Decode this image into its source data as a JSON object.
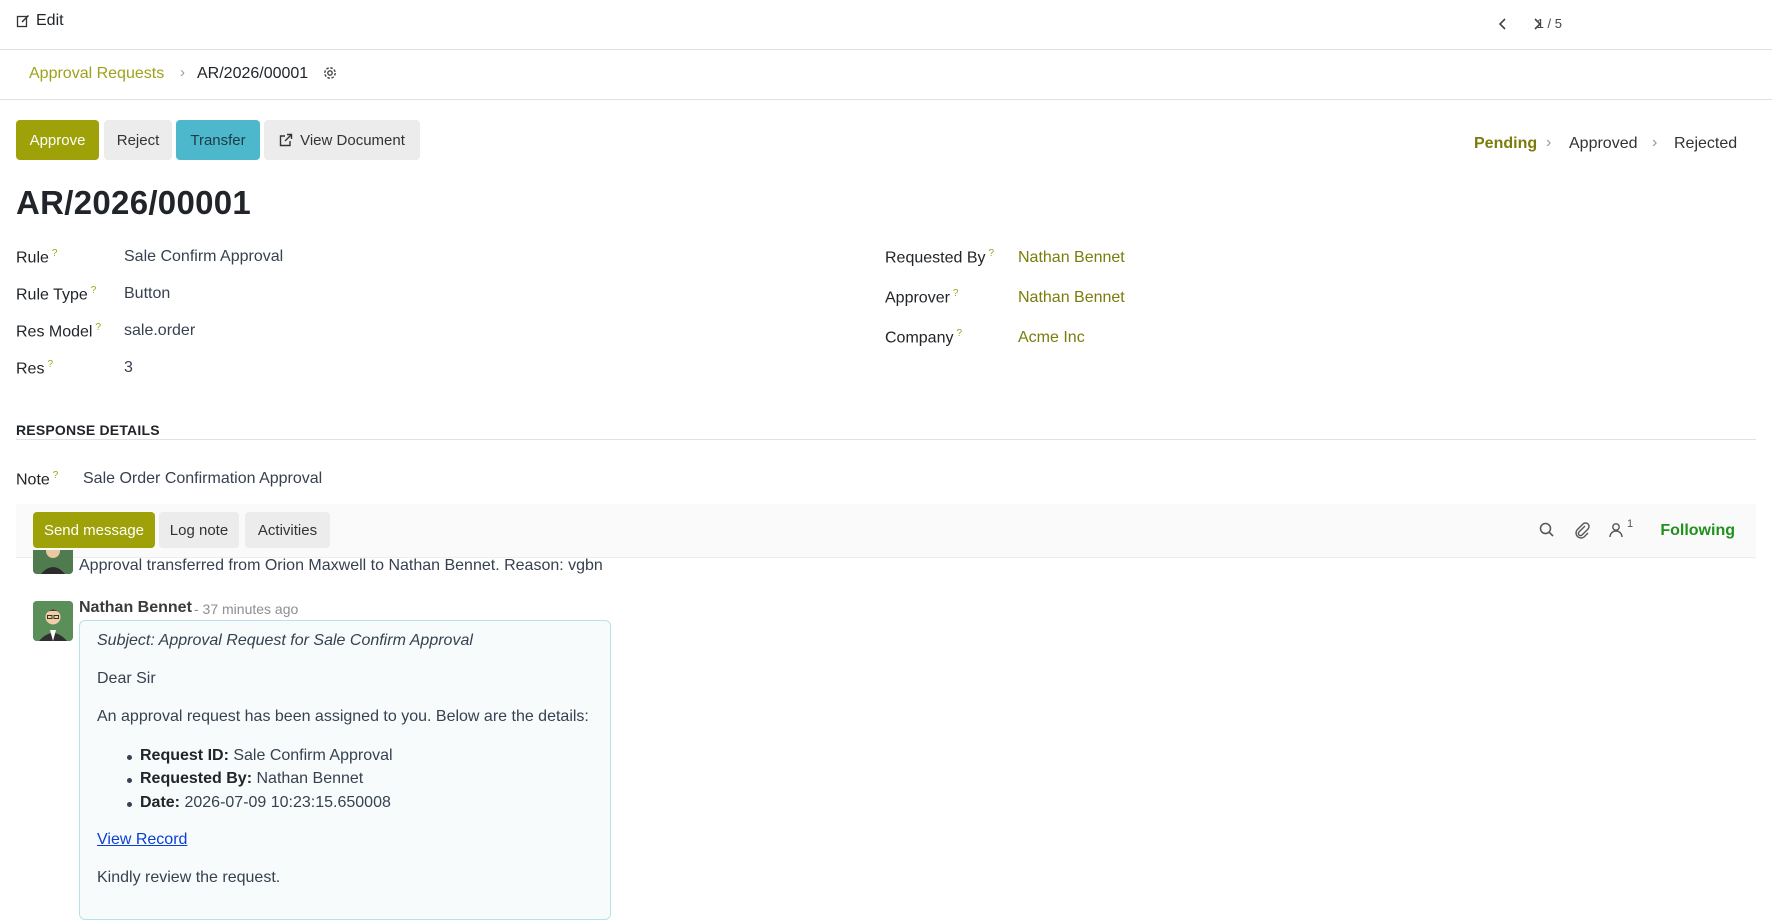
{
  "topbar": {
    "edit_label": "Edit",
    "pager": "1 / 5"
  },
  "breadcrumb": {
    "parent": "Approval Requests",
    "current": "AR/2026/00001"
  },
  "actions": {
    "approve": "Approve",
    "reject": "Reject",
    "transfer": "Transfer",
    "view_document": "View Document"
  },
  "status": {
    "steps": [
      "Pending",
      "Approved",
      "Rejected"
    ],
    "active": "Pending"
  },
  "record": {
    "title": "AR/2026/00001",
    "left_fields": [
      {
        "label": "Rule",
        "value": "Sale Confirm Approval"
      },
      {
        "label": "Rule Type",
        "value": "Button"
      },
      {
        "label": "Res Model",
        "value": "sale.order"
      },
      {
        "label": "Res",
        "value": "3"
      }
    ],
    "right_fields": [
      {
        "label": "Requested By",
        "value": "Nathan Bennet"
      },
      {
        "label": "Approver",
        "value": "Nathan Bennet"
      },
      {
        "label": "Company",
        "value": "Acme Inc"
      }
    ],
    "help_mark": "?"
  },
  "response": {
    "section_title": "RESPONSE DETAILS",
    "note_label": "Note",
    "note_value": "Sale Order Confirmation Approval"
  },
  "chatter": {
    "send_message": "Send message",
    "log_note": "Log note",
    "activities": "Activities",
    "followers_count": "1",
    "following": "Following",
    "messages": [
      {
        "text": "Approval transferred from Orion Maxwell to Nathan Bennet. Reason: vgbn"
      },
      {
        "author": "Nathan Bennet",
        "time": "- 37 minutes ago",
        "subject": "Subject: Approval Request for Sale Confirm Approval",
        "greeting": "Dear Sir",
        "intro": "An approval request has been assigned to you. Below are the details:",
        "details": [
          {
            "key": "Request ID:",
            "value": "Sale Confirm Approval"
          },
          {
            "key": "Requested By:",
            "value": "Nathan Bennet"
          },
          {
            "key": "Date:",
            "value": "2026-07-09 10:23:15.650008"
          }
        ],
        "link": "View Record",
        "closing": "Kindly review the request."
      }
    ]
  },
  "colors": {
    "primary": "#9ea107",
    "link_olive": "#7a7c0b",
    "transfer": "#4db8cc",
    "following": "#21911e"
  }
}
